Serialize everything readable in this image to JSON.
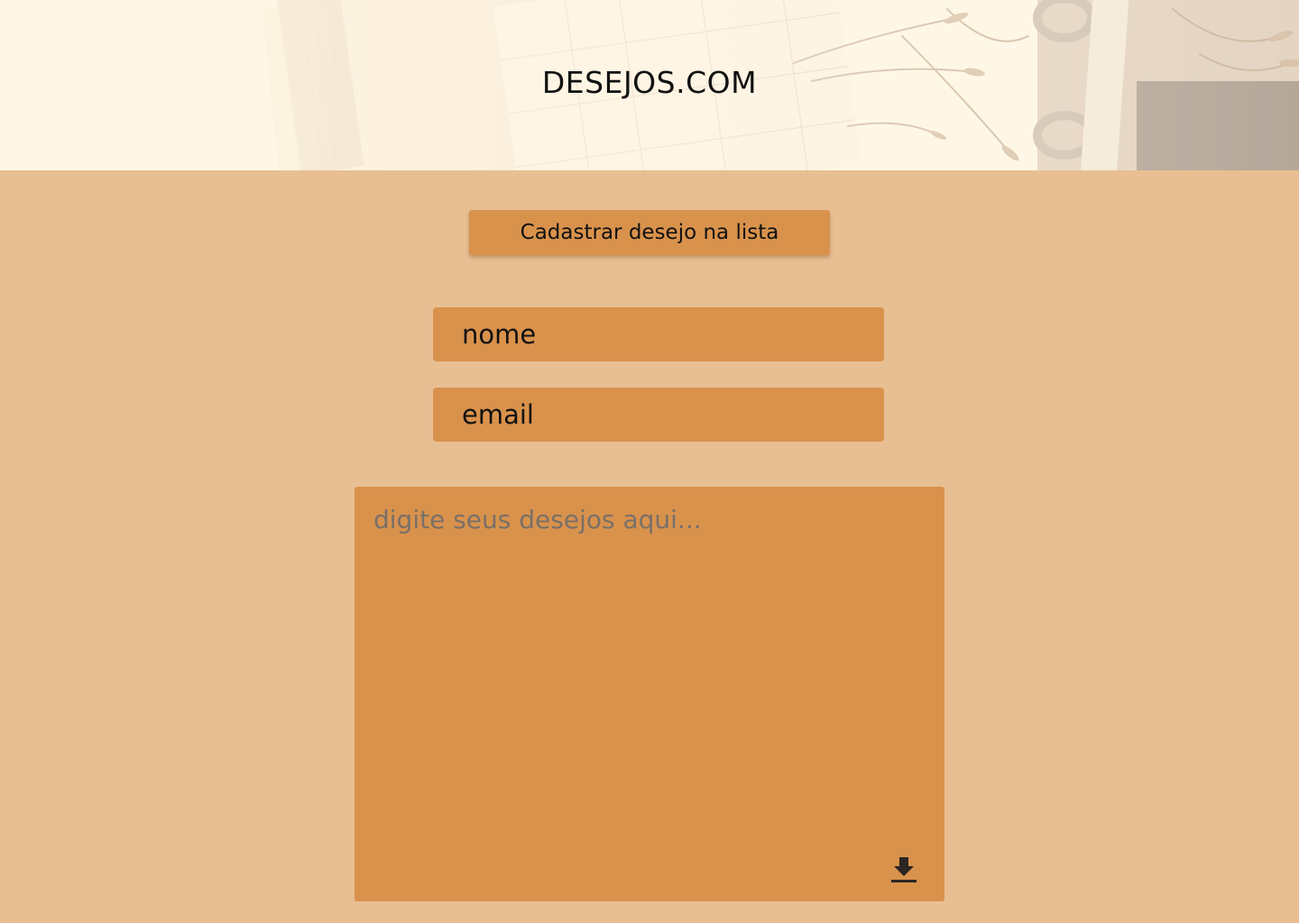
{
  "header": {
    "title": "DESEJOS.COM"
  },
  "form": {
    "submit_label": "Cadastrar desejo na lista",
    "name_placeholder": "nome",
    "email_placeholder": "email",
    "wishes_placeholder": "digite seus desejos aqui...",
    "save_icon": "download-icon"
  },
  "colors": {
    "page_background": "#e8bf93",
    "header_background": "#fff8e6",
    "accent": "#d9924c",
    "text": "#111111"
  }
}
